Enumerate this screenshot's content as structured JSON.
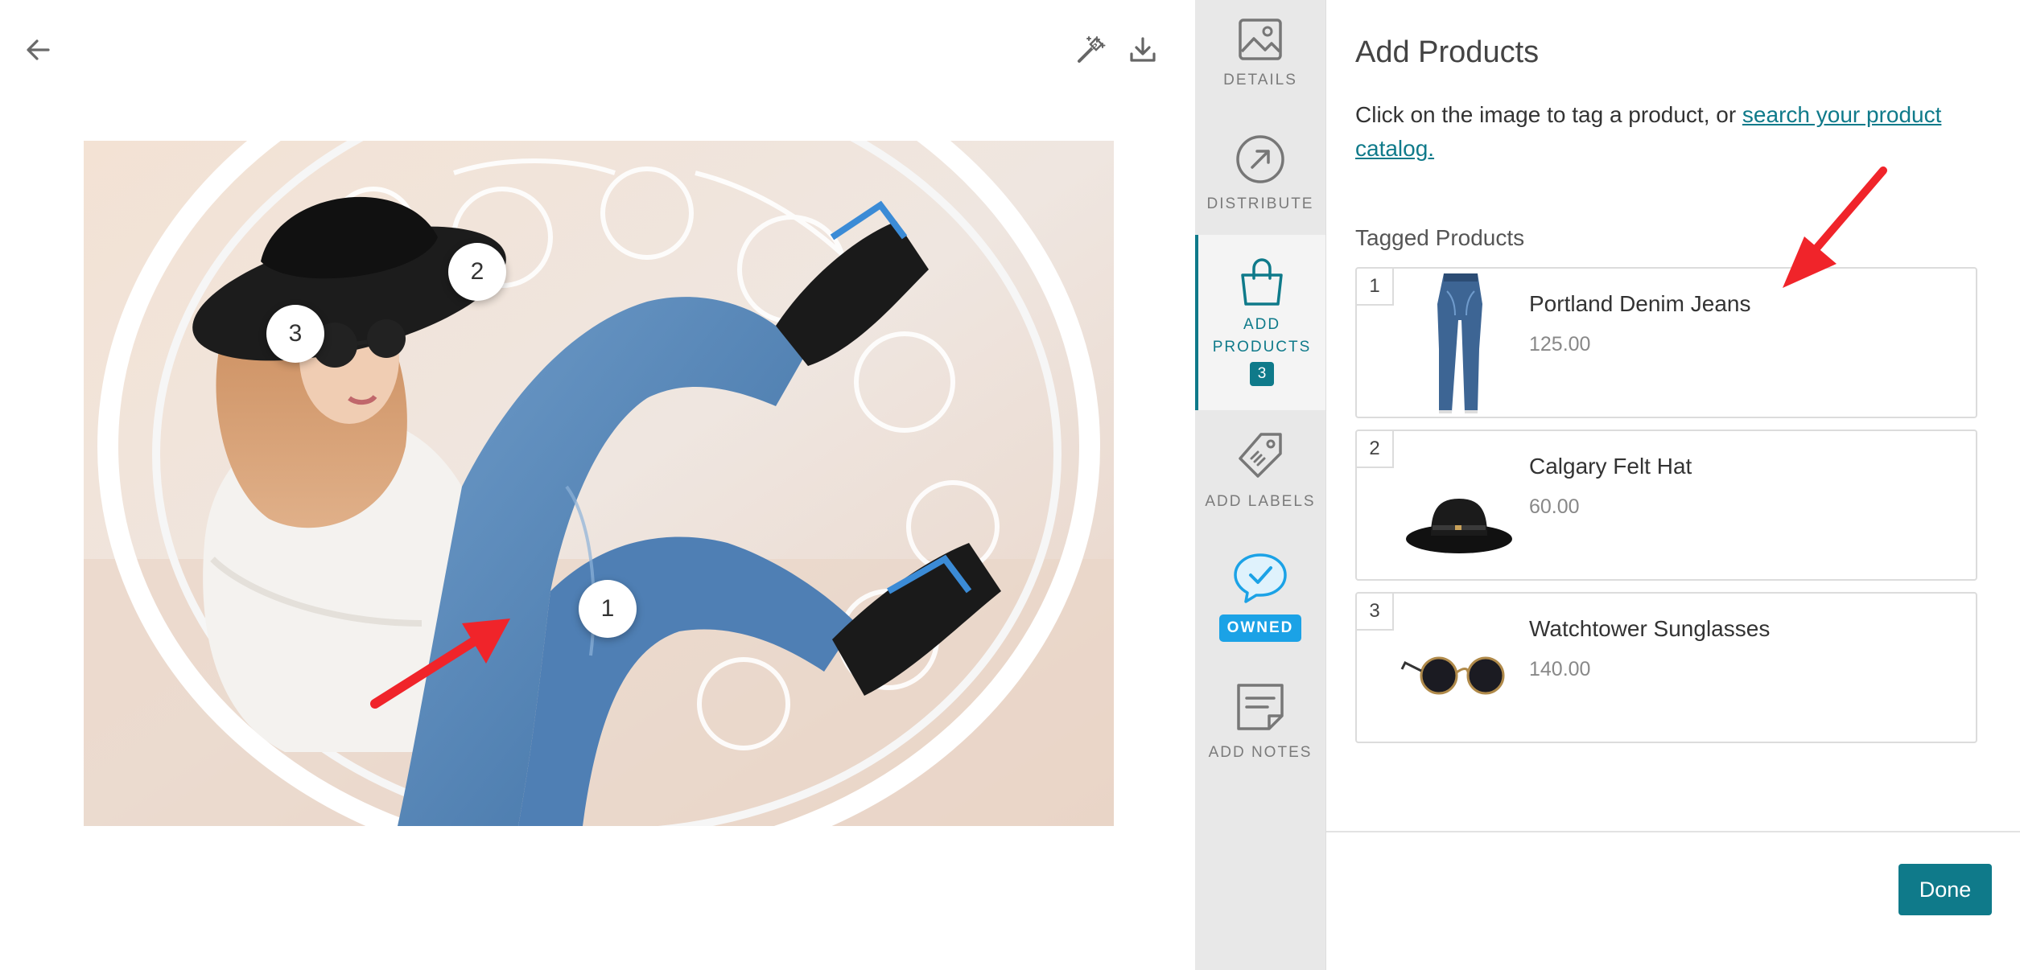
{
  "editor": {
    "back_icon": "arrow-left-icon",
    "tools": [
      {
        "icon": "magic-wand-icon"
      },
      {
        "icon": "download-icon"
      }
    ],
    "hotspots": [
      {
        "label": "1"
      },
      {
        "label": "2"
      },
      {
        "label": "3"
      }
    ]
  },
  "rail": {
    "items": [
      {
        "label": "DETAILS",
        "icon": "image-icon"
      },
      {
        "label": "DISTRIBUTE",
        "icon": "share-arrow-icon"
      },
      {
        "label": "ADD\nPRODUCTS",
        "icon": "shopping-bag-icon",
        "badge": "3",
        "active": true
      },
      {
        "label": "ADD LABELS",
        "icon": "tag-icon"
      },
      {
        "label": "OWNED",
        "icon": "check-bubble-icon"
      },
      {
        "label": "ADD NOTES",
        "icon": "note-icon"
      }
    ]
  },
  "panel": {
    "title": "Add Products",
    "instruction_prefix": "Click on the image to tag a product, or ",
    "instruction_link": "search your product catalog.",
    "tagged_heading": "Tagged Products",
    "products": [
      {
        "number": "1",
        "name": "Portland Denim Jeans",
        "price": "125.00"
      },
      {
        "number": "2",
        "name": "Calgary Felt Hat",
        "price": "60.00"
      },
      {
        "number": "3",
        "name": "Watchtower Sunglasses",
        "price": "140.00"
      }
    ],
    "done_label": "Done"
  },
  "colors": {
    "accent": "#0f7a8a",
    "owned": "#1ba2e6",
    "annotation_arrow": "#f0242a"
  }
}
